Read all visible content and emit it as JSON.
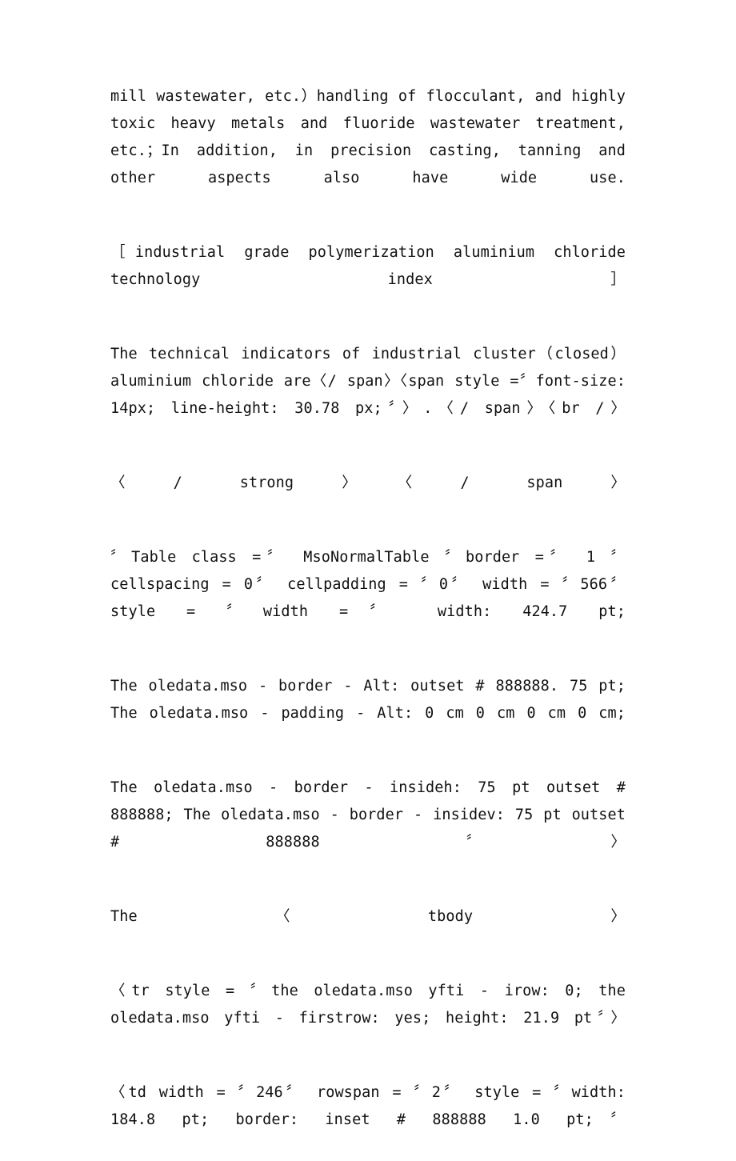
{
  "document": {
    "background_color": "#ffffff",
    "text_color": "#111111",
    "paragraphs": [
      {
        "id": "p-applications",
        "text": "mill wastewater, etc.）handling of flocculant, and highly toxic heavy metals and fluoride wastewater treatment, etc.；In addition, in precision casting, tanning and other aspects also have wide use."
      },
      {
        "id": "p-heading-tech-index",
        "text": "［industrial grade polymerization aluminium chloride technology index］"
      },
      {
        "id": "p-technical-indicators",
        "text": "The technical indicators of industrial cluster（closed）aluminium chloride are〈/ span〉〈span style =〞font-size: 14px; line-height: 30.78 px;〞〉.〈/ span〉〈br /〉"
      },
      {
        "id": "p-close-strong-span",
        "text": "〈/ strong〉〈/ span〉"
      },
      {
        "id": "p-table-open-tag",
        "text": "〞Table class =〞 MsoNormalTable 〞border =〞 1 〞cellspacing = 0〞 cellpadding = 〞0〞 width = 〞566〞 style = 〞width =〞 width: 424.7 pt;"
      },
      {
        "id": "p-border-alt",
        "text": "The oledata.mso - border - Alt: outset # 888888. 75 pt; The oledata.mso - padding - Alt: 0 cm 0 cm 0 cm 0 cm;"
      },
      {
        "id": "p-border-inside",
        "text": "The oledata.mso - border - insideh: 75 pt outset # 888888; The oledata.mso - border - insidev: 75 pt outset # 888888 〞〉"
      },
      {
        "id": "p-tbody",
        "text": "The〈tbody〉"
      },
      {
        "id": "p-tr-style",
        "text": "〈tr style = 〞the oledata.mso yfti - irow: 0; the oledata.mso yfti - firstrow: yes; height: 21.9 pt〞〉"
      },
      {
        "id": "p-td-style",
        "text": "〈td width = 〞246〞 rowspan = 〞2〞 style = 〞width: 184.8 pt; border: inset # 888888 1.0 pt;〞"
      }
    ]
  }
}
